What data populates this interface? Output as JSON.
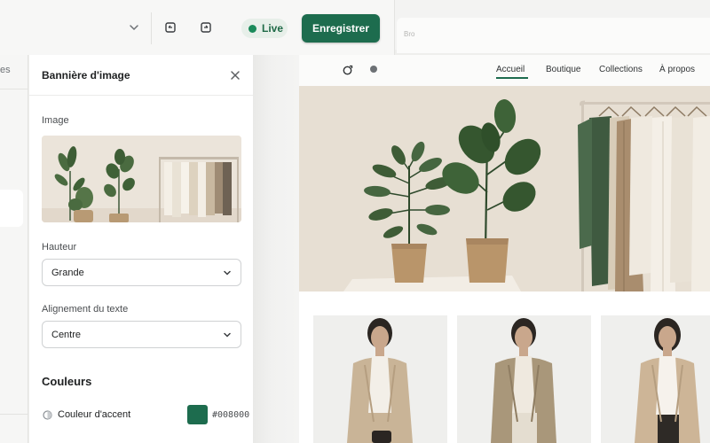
{
  "toolbar": {
    "live_label": "Live",
    "save_label": "Enregistrer",
    "faint_text": "Bro"
  },
  "left_rail": {
    "text": "es"
  },
  "panel": {
    "title": "Bannière d'image",
    "image_label": "Image",
    "height_label": "Hauteur",
    "height_value": "Grande",
    "align_label": "Alignement du texte",
    "align_value": "Centre",
    "colors_title": "Couleurs",
    "accent_label": "Couleur d'accent",
    "accent_hex": "#008000",
    "accent_swatch_color": "#1d6c4e"
  },
  "preview": {
    "nav": [
      {
        "label": "Accueil",
        "active": true
      },
      {
        "label": "Boutique",
        "active": false
      },
      {
        "label": "Collections",
        "active": false
      },
      {
        "label": "À propos",
        "active": false
      }
    ]
  },
  "colors": {
    "brand_green": "#1d6c4e",
    "live_green": "#1a8a5a"
  },
  "icons": [
    "chevron-down-icon",
    "undo-icon",
    "redo-icon",
    "close-icon",
    "preview-icon",
    "dot-icon",
    "color-icon"
  ]
}
